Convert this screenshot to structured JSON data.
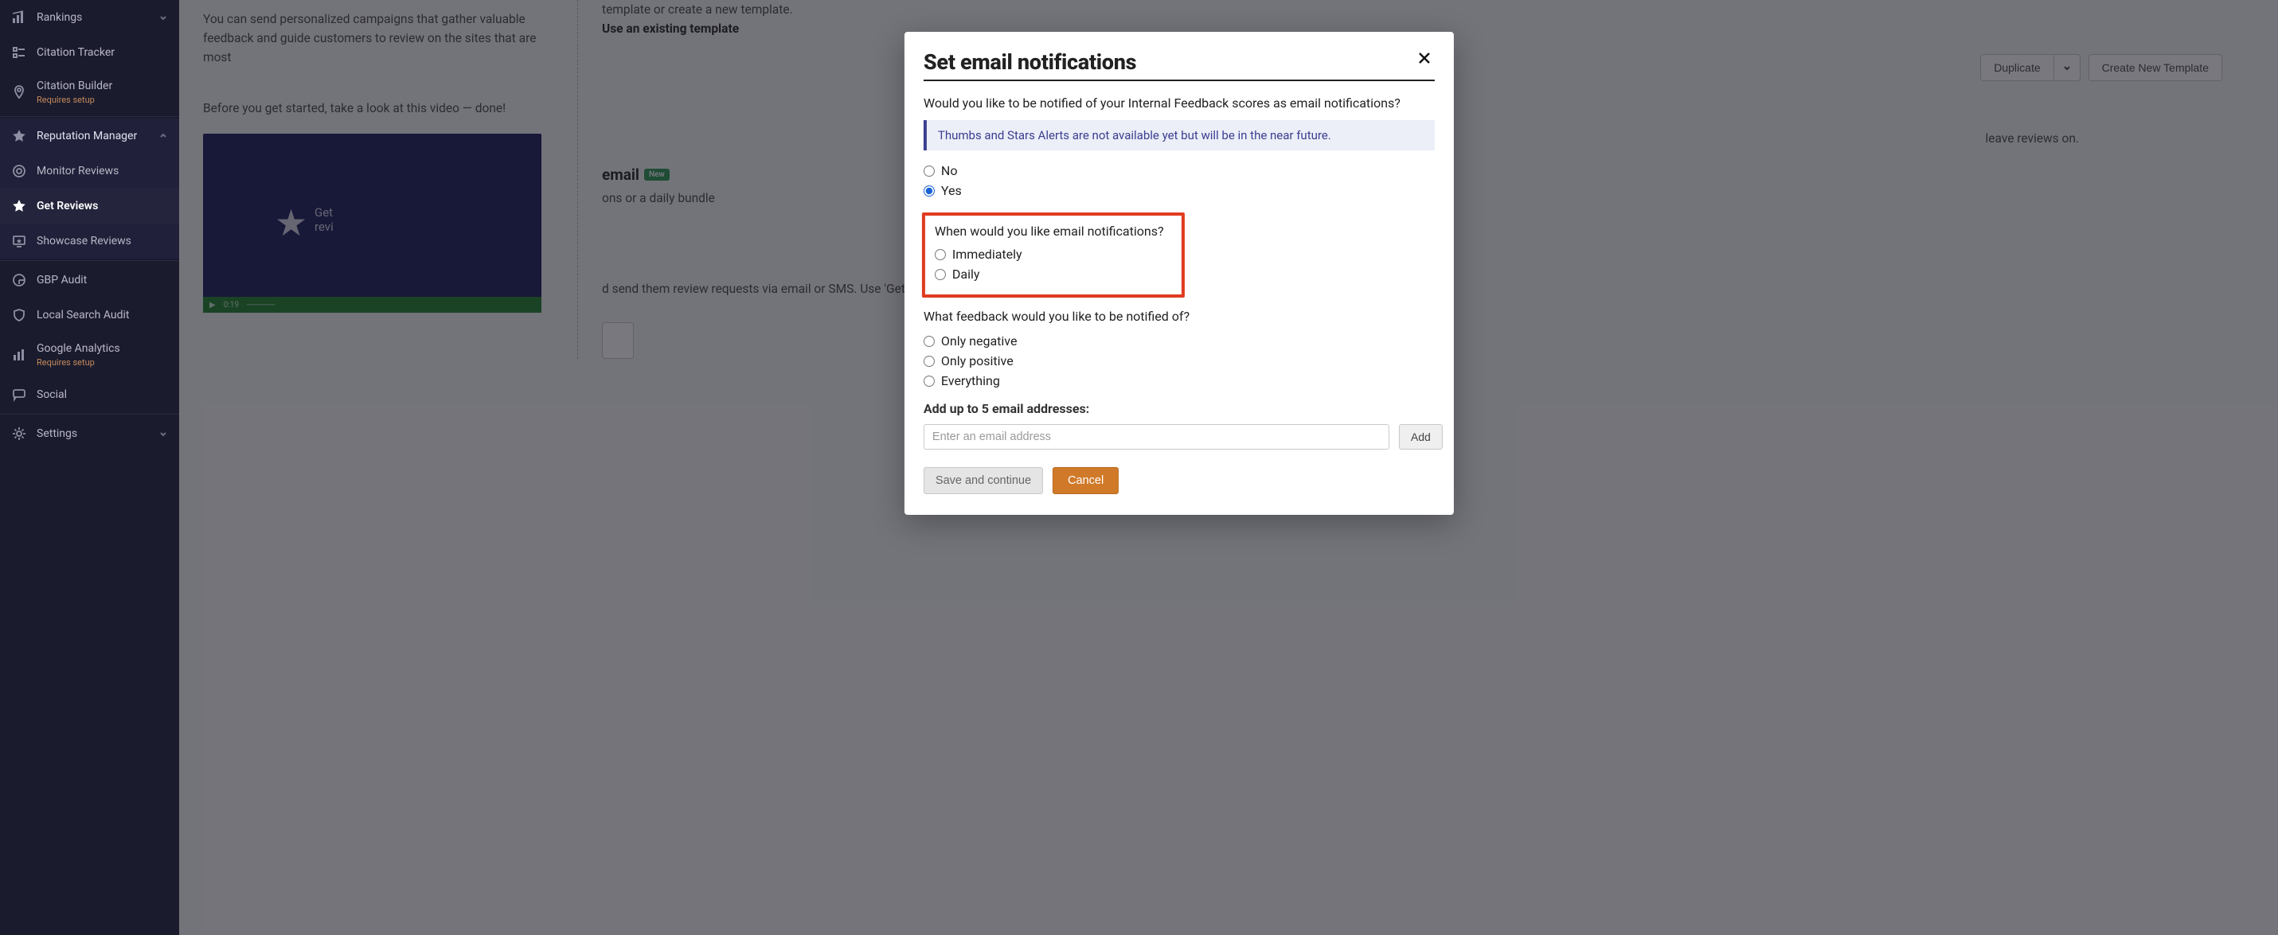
{
  "sidebar": {
    "items": [
      {
        "label": "Rankings",
        "icon": "bars-icon",
        "expandable": true
      },
      {
        "label": "Citation Tracker",
        "icon": "list-icon"
      },
      {
        "label": "Citation Builder",
        "icon": "pin-icon",
        "sub": "Requires setup"
      },
      {
        "label": "Reputation Manager",
        "icon": "star-icon",
        "expandable": true,
        "expanded": true,
        "children": [
          {
            "label": "Monitor Reviews",
            "icon": "target-icon"
          },
          {
            "label": "Get Reviews",
            "icon": "star-plus-icon",
            "active": true
          },
          {
            "label": "Showcase Reviews",
            "icon": "monitor-star-icon"
          }
        ]
      },
      {
        "label": "GBP Audit",
        "icon": "google-icon"
      },
      {
        "label": "Local Search Audit",
        "icon": "shield-icon"
      },
      {
        "label": "Google Analytics",
        "icon": "chart-icon",
        "sub": "Requires setup"
      },
      {
        "label": "Social",
        "icon": "chat-icon"
      },
      {
        "label": "Settings",
        "icon": "gear-icon",
        "expandable": true
      }
    ]
  },
  "background": {
    "intro1": "You can send personalized campaigns that gather valuable feedback and guide customers to review on the sites that are most",
    "intro2": "Before you get started, take a look at this video — done!",
    "video_caption_line1": "Get",
    "video_caption_line2": "revi",
    "video_time": "0:19",
    "template_line1": "template or create a new template.",
    "template_line2": "Use an existing template",
    "duplicate": "Duplicate",
    "create_template": "Create New Template",
    "right_text1": "leave reviews on.",
    "heading_email": "email",
    "badge_new": "New",
    "right_text2": "ons or a daily bundle",
    "right_text3": "d send them review requests via email or SMS. Use 'Get for use in in-store kiosks, online sharing, or somewhere"
  },
  "modal": {
    "title": "Set email notifications",
    "q_notify": "Would you like to be notified of your Internal Feedback scores as email notifications?",
    "banner": "Thumbs and Stars Alerts are not available yet but will be in the near future.",
    "opt_no": "No",
    "opt_yes": "Yes",
    "q_when": "When would you like email notifications?",
    "opt_immediately": "Immediately",
    "opt_daily": "Daily",
    "q_what": "What feedback would you like to be notified of?",
    "opt_neg": "Only negative",
    "opt_pos": "Only positive",
    "opt_all": "Everything",
    "q_emails": "Add up to 5 email addresses:",
    "email_placeholder": "Enter an email address",
    "btn_add": "Add",
    "btn_save": "Save and continue",
    "btn_cancel": "Cancel",
    "selected_notify": "yes"
  }
}
